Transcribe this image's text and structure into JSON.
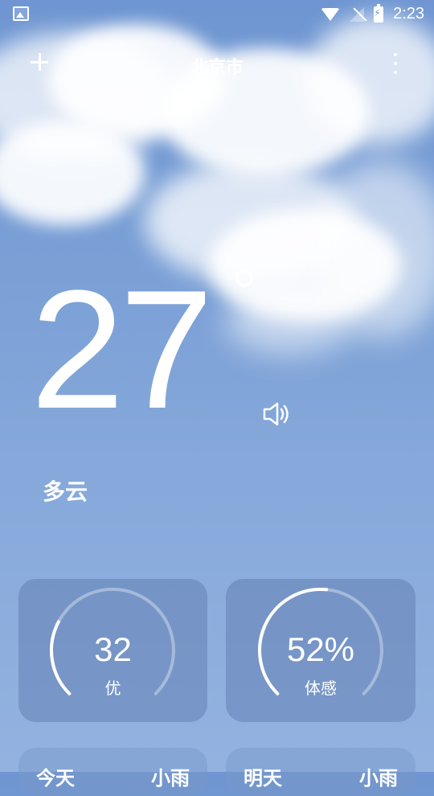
{
  "statusbar": {
    "time": "2:23"
  },
  "appbar": {
    "city": "北京市"
  },
  "weather": {
    "temperature": "27",
    "condition": "多云"
  },
  "gauges": [
    {
      "value": "32",
      "label": "优",
      "fraction": 0.27
    },
    {
      "value": "52%",
      "label": "体感",
      "fraction": 0.52
    }
  ],
  "bottom_cards": [
    {
      "left": "今天",
      "right": "小雨"
    },
    {
      "left": "明天",
      "right": "小雨"
    }
  ],
  "colors": {
    "accent": "#ffffff"
  }
}
